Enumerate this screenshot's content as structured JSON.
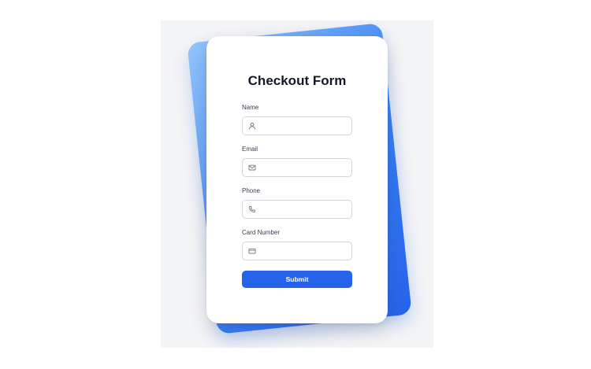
{
  "form": {
    "title": "Checkout Form",
    "fields": [
      {
        "label": "Name",
        "icon": "user-icon",
        "value": "",
        "placeholder": ""
      },
      {
        "label": "Email",
        "icon": "envelope-icon",
        "value": "",
        "placeholder": ""
      },
      {
        "label": "Phone",
        "icon": "phone-icon",
        "value": "",
        "placeholder": ""
      },
      {
        "label": "Card Number",
        "icon": "credit-card-icon",
        "value": "",
        "placeholder": ""
      }
    ],
    "submit_label": "Submit"
  },
  "colors": {
    "accent": "#2563eb",
    "background": "#f3f4f6",
    "card": "#ffffff"
  }
}
